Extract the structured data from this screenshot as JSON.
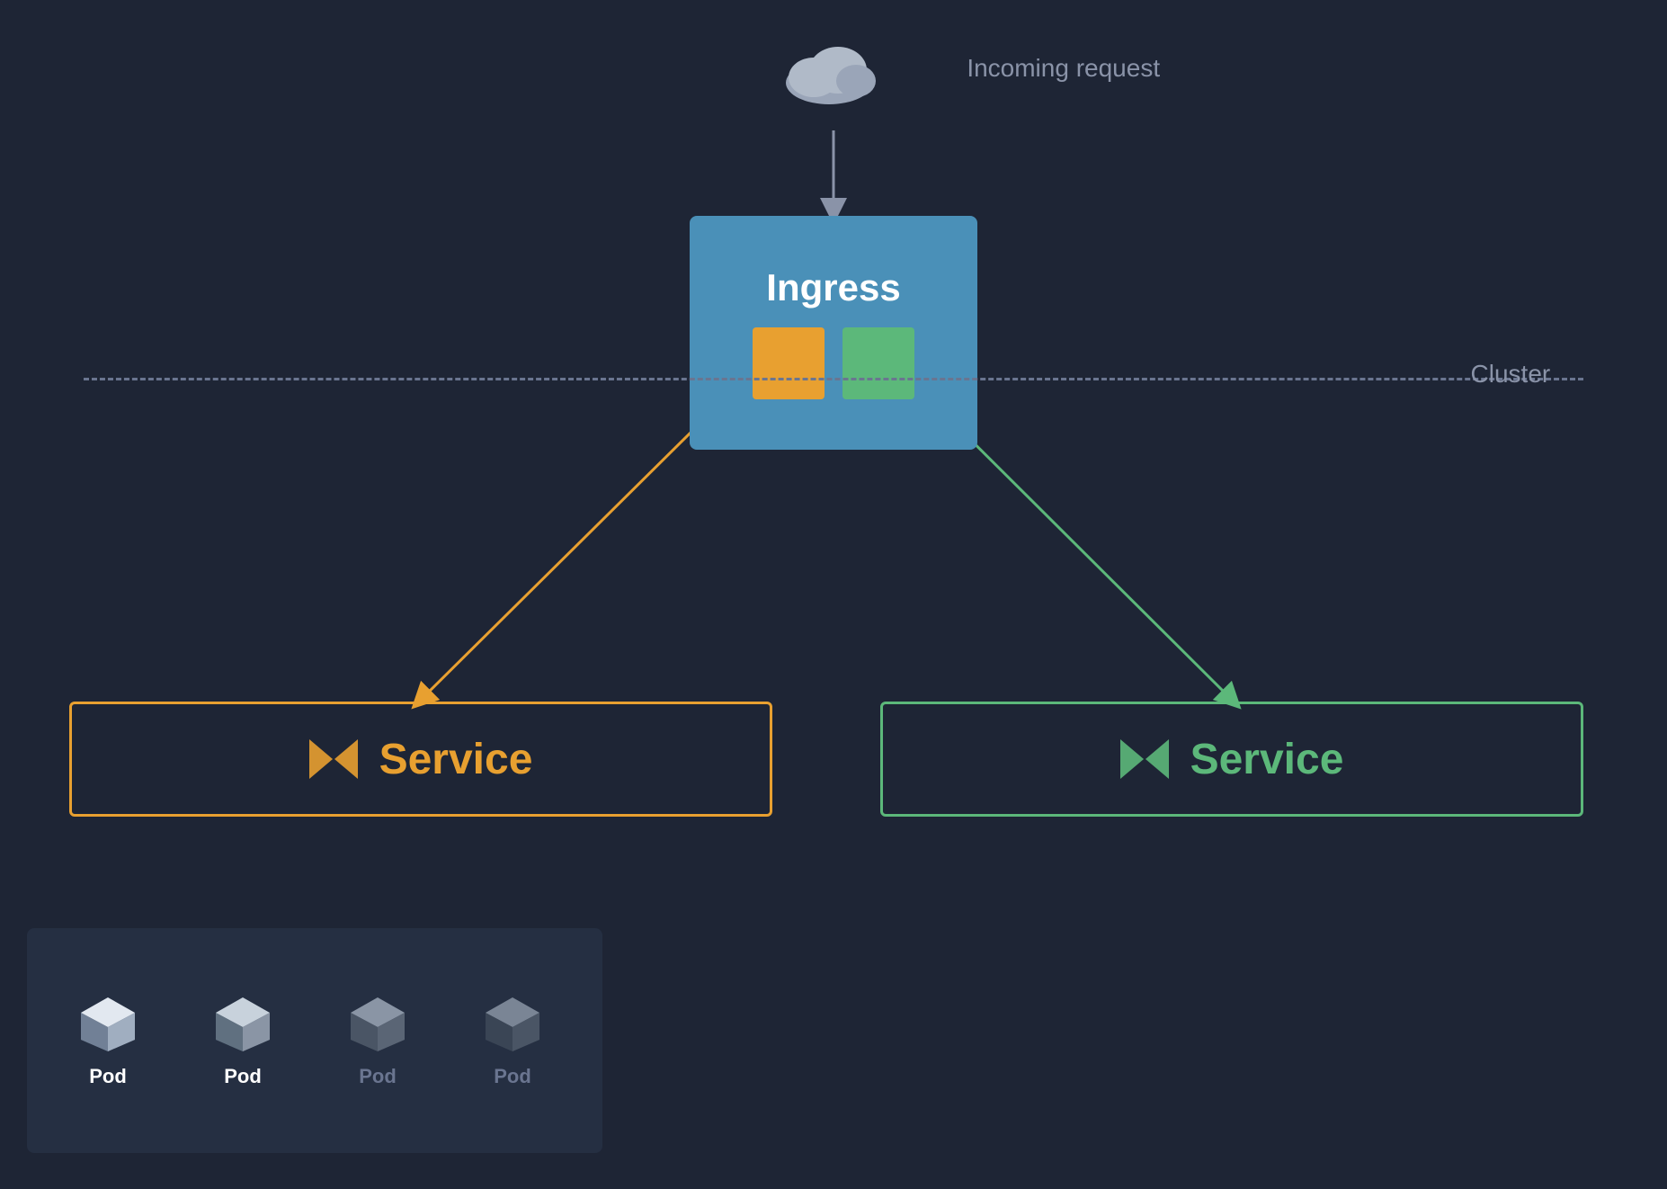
{
  "diagram": {
    "background_color": "#1e2535",
    "incoming_label": "Incoming request",
    "cluster_label": "Cluster",
    "ingress_title": "Ingress",
    "service_orange_label": "Service",
    "service_green_label": "Service",
    "pods": [
      {
        "label": "Pod",
        "active": true
      },
      {
        "label": "Pod",
        "active": true
      },
      {
        "label": "Pod",
        "active": false
      },
      {
        "label": "Pod",
        "active": false
      }
    ],
    "colors": {
      "orange": "#e8a030",
      "green": "#5cb87a",
      "blue": "#4a90b8",
      "text_muted": "#8a93a8",
      "pod_active_text": "#ffffff",
      "pod_inactive_text": "#6a7590",
      "bg_dark": "#1e2535",
      "bg_pod_section": "#252f42"
    }
  }
}
